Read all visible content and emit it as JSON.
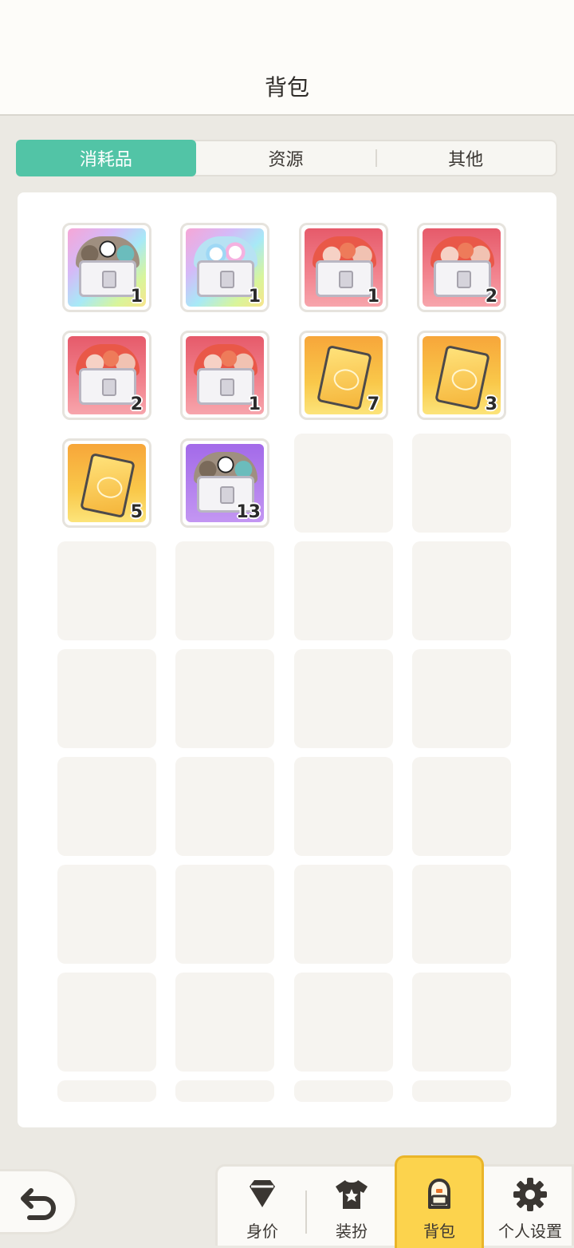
{
  "header": {
    "title": "背包"
  },
  "tabs": [
    {
      "label": "消耗品",
      "active": true
    },
    {
      "label": "资源",
      "active": false
    },
    {
      "label": "其他",
      "active": false
    }
  ],
  "items": [
    {
      "icon": "character-chest-icon",
      "style": "rainbow",
      "count": "1"
    },
    {
      "icon": "orb-chest-icon",
      "style": "rainbow",
      "count": "1"
    },
    {
      "icon": "red-card-chest-icon",
      "style": "red",
      "count": "1"
    },
    {
      "icon": "red-card-chest-icon",
      "style": "red",
      "count": "2"
    },
    {
      "icon": "red-card-chest-icon",
      "style": "red",
      "count": "2"
    },
    {
      "icon": "red-card-chest-icon",
      "style": "red",
      "count": "1"
    },
    {
      "icon": "gold-ticket-icon",
      "style": "gold",
      "count": "7"
    },
    {
      "icon": "gold-ticket-icon",
      "style": "gold",
      "count": "3"
    },
    {
      "icon": "gold-ticket-icon",
      "style": "gold",
      "count": "5"
    },
    {
      "icon": "character-chest-icon",
      "style": "purple",
      "count": "13"
    }
  ],
  "nav": [
    {
      "label": "身价",
      "icon": "diamond-icon",
      "active": false
    },
    {
      "label": "装扮",
      "icon": "shirt-star-icon",
      "active": false
    },
    {
      "label": "背包",
      "icon": "backpack-icon",
      "active": true
    },
    {
      "label": "个人设置",
      "icon": "gear-icon",
      "active": false
    }
  ],
  "back": {
    "icon": "back-arrow-icon"
  },
  "colors": {
    "accent": "#52c4a6",
    "nav_active": "#fcd34d"
  }
}
